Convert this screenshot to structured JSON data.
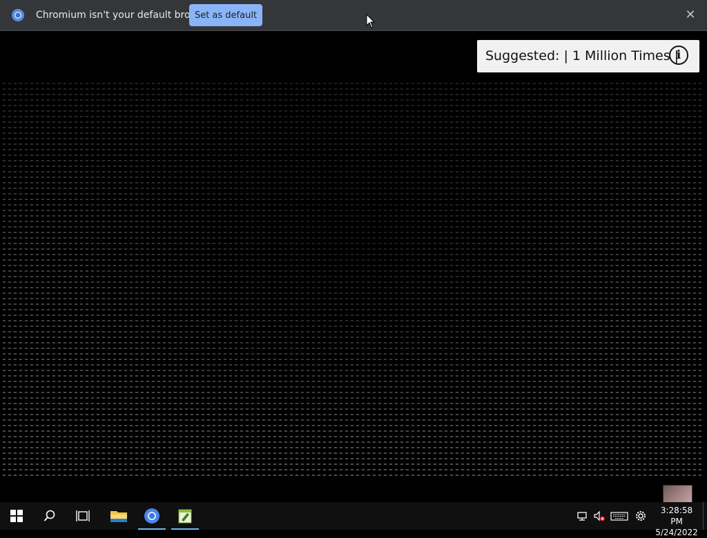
{
  "infobar": {
    "message": "Chromium isn't your default browser",
    "set_default_label": "Set as default",
    "close_glyph": "✕"
  },
  "video": {
    "suggested_label": "Suggested: | 1 Million Times |",
    "info_glyph": "i"
  },
  "taskbar": {
    "items": [
      "start-icon",
      "search-icon",
      "task-view-icon",
      "file-explorer-icon",
      "chromium-icon",
      "notepad-plus-icon"
    ],
    "clock_time": "3:28:58 PM",
    "clock_date": "5/24/2022"
  },
  "colors": {
    "infobar_bg": "#35363a",
    "button_accent": "#8ab4f8",
    "taskbar_bg": "#101010",
    "active_indicator": "#76b9ed"
  }
}
